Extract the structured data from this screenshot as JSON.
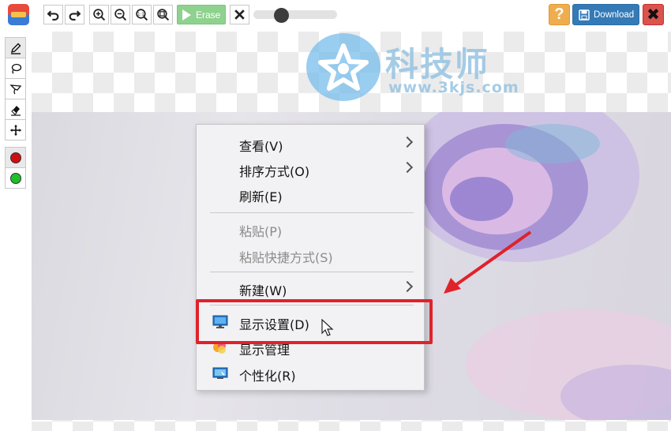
{
  "toolbar": {
    "erase_label": "Erase",
    "download_label": "Download",
    "help_label": "?",
    "close_symbol": "✖",
    "icons": [
      "undo-icon",
      "redo-icon",
      "zoom-in-icon",
      "zoom-out-icon",
      "zoom-actual-icon",
      "zoom-fit-icon",
      "clear-icon"
    ],
    "brush_size_fraction": 0.3
  },
  "tools": [
    "pencil-icon",
    "lasso-icon",
    "polygon-lasso-icon",
    "eraser-icon",
    "move-icon"
  ],
  "colors": {
    "red": "#cc1111",
    "green": "#1fbf2a",
    "accent_blue": "#337ab7",
    "help_orange": "#f0ad4e",
    "close_red": "#d9534f"
  },
  "watermark": {
    "title": "科技师",
    "url": "www.3kjs.com"
  },
  "context_menu": {
    "items": [
      {
        "label": "查看(V)",
        "submenu": true,
        "disabled": false
      },
      {
        "label": "排序方式(O)",
        "submenu": true,
        "disabled": false
      },
      {
        "label": "刷新(E)",
        "submenu": false,
        "disabled": false
      },
      {
        "label": "粘贴(P)",
        "submenu": false,
        "disabled": true
      },
      {
        "label": "粘贴快捷方式(S)",
        "submenu": false,
        "disabled": true
      },
      {
        "label": "新建(W)",
        "submenu": true,
        "disabled": false
      },
      {
        "label": "显示设置(D)",
        "submenu": false,
        "disabled": false,
        "icon": "display-icon"
      },
      {
        "label": "显示管理",
        "submenu": false,
        "disabled": false,
        "icon": "display-manager-icon"
      },
      {
        "label": "个性化(R)",
        "submenu": false,
        "disabled": false,
        "icon": "personalize-icon"
      }
    ]
  }
}
